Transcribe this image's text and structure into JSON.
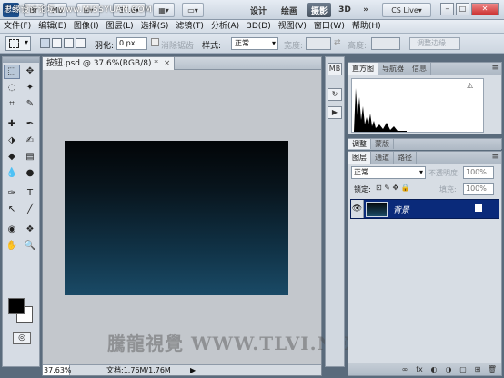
{
  "watermark_top": "思缘设计论坛 www.MISSYUAN.COM",
  "appbar": {
    "logo": "Ps",
    "zoom": "37.6",
    "workspaces": [
      "设计",
      "绘画",
      "摄影",
      "3D"
    ],
    "active_workspace": "摄影",
    "more": "»",
    "cslive": "CS Live",
    "minimize": "–",
    "restore": "□",
    "close": "✕"
  },
  "menus": [
    "文件(F)",
    "编辑(E)",
    "图像(I)",
    "图层(L)",
    "选择(S)",
    "滤镜(T)",
    "分析(A)",
    "3D(D)",
    "视图(V)",
    "窗口(W)",
    "帮助(H)"
  ],
  "options": {
    "feather_label": "羽化:",
    "feather_value": "0 px",
    "antialias_label": "消除锯齿",
    "style_label": "样式:",
    "style_value": "正常",
    "width_label": "宽度:",
    "height_label": "高度:",
    "refine_edge": "调整边缘..."
  },
  "tools": {
    "rows": [
      [
        "⬚",
        "✥"
      ],
      [
        "◌",
        "✦"
      ],
      [
        "⌗",
        "✎"
      ],
      [
        "✚",
        "✒"
      ],
      [
        "⬗",
        "✍"
      ],
      [
        "◆",
        "▤"
      ],
      [
        "💧",
        "●"
      ],
      [
        "✑",
        "T"
      ],
      [
        "↖",
        "╱"
      ],
      [
        "◉",
        "❖"
      ],
      [
        "✋",
        "🔍"
      ]
    ],
    "quickmask": "◎"
  },
  "document": {
    "tab_title": "按钮.psd @ 37.6%(RGB/8) *",
    "tab_close": "×",
    "zoom": "37.63%",
    "info": "文档:1.76M/1.76M",
    "info_arrow": "▶"
  },
  "watermark": "騰龍視覺 WWW.TLVI.NET",
  "iconcol": [
    "MB",
    "↻",
    "▶"
  ],
  "panels": {
    "histogram_tabs": [
      "直方图",
      "导航器",
      "信息"
    ],
    "histogram_warning": "⚠",
    "adjust_tabs": [
      "调整",
      "蒙版"
    ],
    "layer_tabs": [
      "图层",
      "通道",
      "路径"
    ],
    "menu_icon": "≡",
    "blend_mode": "正常",
    "opacity_label": "不透明度:",
    "opacity_value": "100%",
    "lock_label": "锁定:",
    "lock_icons": "⊡ ✎ ✥ 🔒",
    "fill_label": "填充:",
    "fill_value": "100%",
    "layer_name": "背景",
    "layer_eye": "👁",
    "footer_icons": [
      "∞",
      "fx",
      "◐",
      "◑",
      "▢",
      "⊞",
      "🗑"
    ]
  },
  "colors": {
    "active_layer": "#0a2a7a",
    "canvas_top": "#020507",
    "canvas_bottom": "#1a4a66",
    "app_bg": "#c3c7cc"
  }
}
